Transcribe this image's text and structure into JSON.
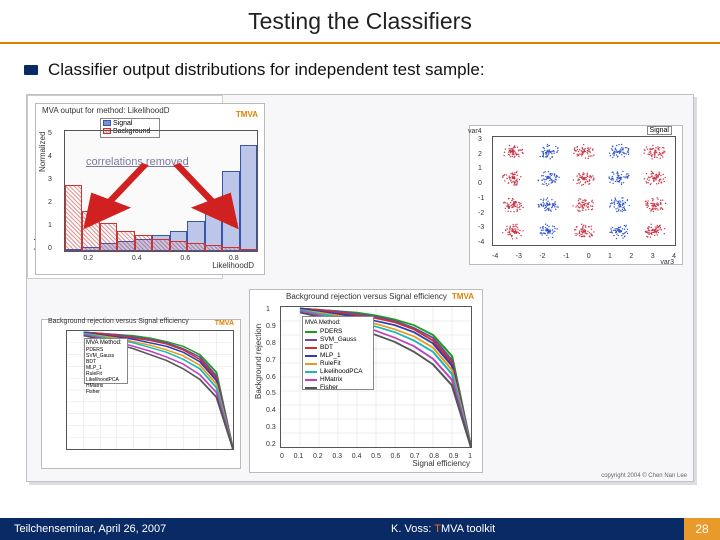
{
  "title": "Testing the Classifiers",
  "bullet": "Classifier output distributions for independent test sample:",
  "chart_data": [
    {
      "type": "bar",
      "title": "MVA output for method: LikelihoodD",
      "brand": "TMVA",
      "xlabel": "LikelihoodD",
      "ylabel": "Normalized",
      "ylim": [
        0,
        6
      ],
      "categories": [
        0.0,
        0.1,
        0.2,
        0.3,
        0.4,
        0.5,
        0.6,
        0.7,
        0.8,
        0.9,
        1.0
      ],
      "series": [
        {
          "name": "Signal",
          "color": "#3a55aa",
          "values": [
            0,
            0.2,
            0.4,
            0.5,
            0.6,
            0.8,
            1.0,
            1.5,
            2.2,
            4.0,
            5.3
          ]
        },
        {
          "name": "Background",
          "color": "#cc3333",
          "values": [
            3.3,
            2.0,
            1.4,
            1.0,
            0.8,
            0.6,
            0.5,
            0.4,
            0.3,
            0.2,
            0.1
          ]
        }
      ],
      "legend": [
        "Signal",
        "Background"
      ],
      "annotation": "correlations removed",
      "xticks": [
        "0.2",
        "0.4",
        "0.6",
        "0.8"
      ],
      "yticks": [
        "0",
        "1",
        "2",
        "3",
        "4",
        "5"
      ]
    },
    {
      "type": "scatter",
      "xlabel": "var3",
      "ylabel": "var4",
      "legend": [
        "Signal"
      ],
      "xlim": [
        -4,
        4
      ],
      "ylim": [
        -4,
        4
      ],
      "series": [
        {
          "name": "Signal",
          "color": "#3355cc"
        },
        {
          "name": "Background",
          "color": "#cc3344"
        }
      ],
      "xticks": [
        "-4",
        "-3",
        "-2",
        "-1",
        "0",
        "1",
        "2",
        "3",
        "4"
      ],
      "yticks": [
        "-4",
        "-3",
        "-2",
        "-1",
        "0",
        "1",
        "2",
        "3"
      ]
    },
    {
      "type": "line",
      "title": "Background rejection versus Signal efficiency",
      "brand": "TMVA",
      "xlabel": "Signal efficiency",
      "ylabel": "Background rejection",
      "xlim": [
        0,
        1
      ],
      "ylim": [
        0,
        1
      ],
      "xticks": [
        "0",
        "0.1",
        "0.2",
        "0.3",
        "0.4",
        "0.5",
        "0.6",
        "0.7",
        "0.8",
        "0.9",
        "1"
      ],
      "yticks": [
        "0.2",
        "0.3",
        "0.4",
        "0.5",
        "0.6",
        "0.7",
        "0.8",
        "0.9",
        "1"
      ],
      "legend_title": "MVA Method:",
      "series": [
        {
          "name": "PDERS",
          "color": "#1a9e1a",
          "x": [
            0.1,
            0.2,
            0.3,
            0.4,
            0.5,
            0.6,
            0.7,
            0.8,
            0.9,
            1.0
          ],
          "y": [
            0.99,
            0.98,
            0.97,
            0.96,
            0.94,
            0.91,
            0.87,
            0.8,
            0.65,
            0.0
          ]
        },
        {
          "name": "SVM_Gauss",
          "color": "#6a4aa0",
          "x": [
            0.1,
            0.2,
            0.3,
            0.4,
            0.5,
            0.6,
            0.7,
            0.8,
            0.9,
            1.0
          ],
          "y": [
            0.99,
            0.98,
            0.97,
            0.95,
            0.93,
            0.9,
            0.85,
            0.78,
            0.62,
            0.0
          ]
        },
        {
          "name": "BDT",
          "color": "#d03030",
          "x": [
            0.1,
            0.2,
            0.3,
            0.4,
            0.5,
            0.6,
            0.7,
            0.8,
            0.9,
            1.0
          ],
          "y": [
            0.99,
            0.98,
            0.96,
            0.94,
            0.92,
            0.89,
            0.84,
            0.76,
            0.6,
            0.0
          ]
        },
        {
          "name": "MLP_1",
          "color": "#2b3fb0",
          "x": [
            0.1,
            0.2,
            0.3,
            0.4,
            0.5,
            0.6,
            0.7,
            0.8,
            0.9,
            1.0
          ],
          "y": [
            0.99,
            0.97,
            0.95,
            0.93,
            0.9,
            0.87,
            0.82,
            0.74,
            0.58,
            0.0
          ]
        },
        {
          "name": "RuleFit",
          "color": "#e59a20",
          "x": [
            0.1,
            0.2,
            0.3,
            0.4,
            0.5,
            0.6,
            0.7,
            0.8,
            0.9,
            1.0
          ],
          "y": [
            0.98,
            0.96,
            0.94,
            0.91,
            0.88,
            0.84,
            0.79,
            0.71,
            0.55,
            0.0
          ]
        },
        {
          "name": "LikelihoodPCA",
          "color": "#1fb5b5",
          "x": [
            0.1,
            0.2,
            0.3,
            0.4,
            0.5,
            0.6,
            0.7,
            0.8,
            0.9,
            1.0
          ],
          "y": [
            0.98,
            0.95,
            0.93,
            0.9,
            0.86,
            0.82,
            0.76,
            0.68,
            0.52,
            0.0
          ]
        },
        {
          "name": "HMatrix",
          "color": "#c040c0",
          "x": [
            0.1,
            0.2,
            0.3,
            0.4,
            0.5,
            0.6,
            0.7,
            0.8,
            0.9,
            1.0
          ],
          "y": [
            0.97,
            0.94,
            0.91,
            0.87,
            0.83,
            0.78,
            0.72,
            0.63,
            0.48,
            0.0
          ]
        },
        {
          "name": "Fisher",
          "color": "#555555",
          "x": [
            0.1,
            0.2,
            0.3,
            0.4,
            0.5,
            0.6,
            0.7,
            0.8,
            0.9,
            1.0
          ],
          "y": [
            0.96,
            0.93,
            0.89,
            0.85,
            0.8,
            0.75,
            0.68,
            0.59,
            0.44,
            0.0
          ]
        }
      ]
    },
    {
      "type": "line",
      "title": "Background rejection versus Signal efficiency",
      "brand": "TMVA",
      "xlabel": "Signal efficiency",
      "ylabel": "Background rejection",
      "legend_title": "MVA Method:",
      "series_ref": 2
    }
  ],
  "illustration_caption": "copyright 2004 © Chen Nan Lee",
  "footer": {
    "left": "Teilchenseminar, April 26, 2007",
    "center_pre": "K. Voss: ",
    "center_t": "T",
    "center_post": "MVA toolkit",
    "page": "28"
  }
}
